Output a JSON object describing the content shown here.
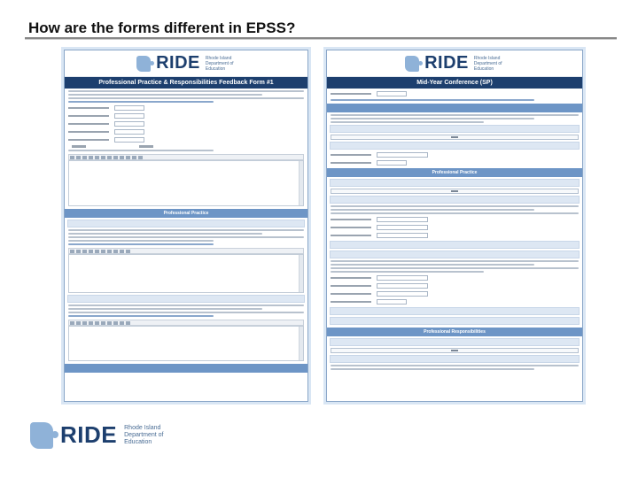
{
  "slide": {
    "title": "How are the forms different in EPSS?"
  },
  "logo": {
    "word": "RIDE",
    "sub": "Rhode Island Department of Education"
  },
  "form_left": {
    "title": "Professional Practice & Responsibilities Feedback Form #1",
    "section_practice": "Professional Practice"
  },
  "form_right": {
    "title": "Mid-Year Conference (SP)",
    "section_practice": "Professional Practice",
    "section_responsibilities": "Professional Responsibilities"
  },
  "colors": {
    "brand_navy": "#1d3f6e",
    "section_blue": "#6d95c6",
    "logo_blue": "#8fb2d8"
  }
}
